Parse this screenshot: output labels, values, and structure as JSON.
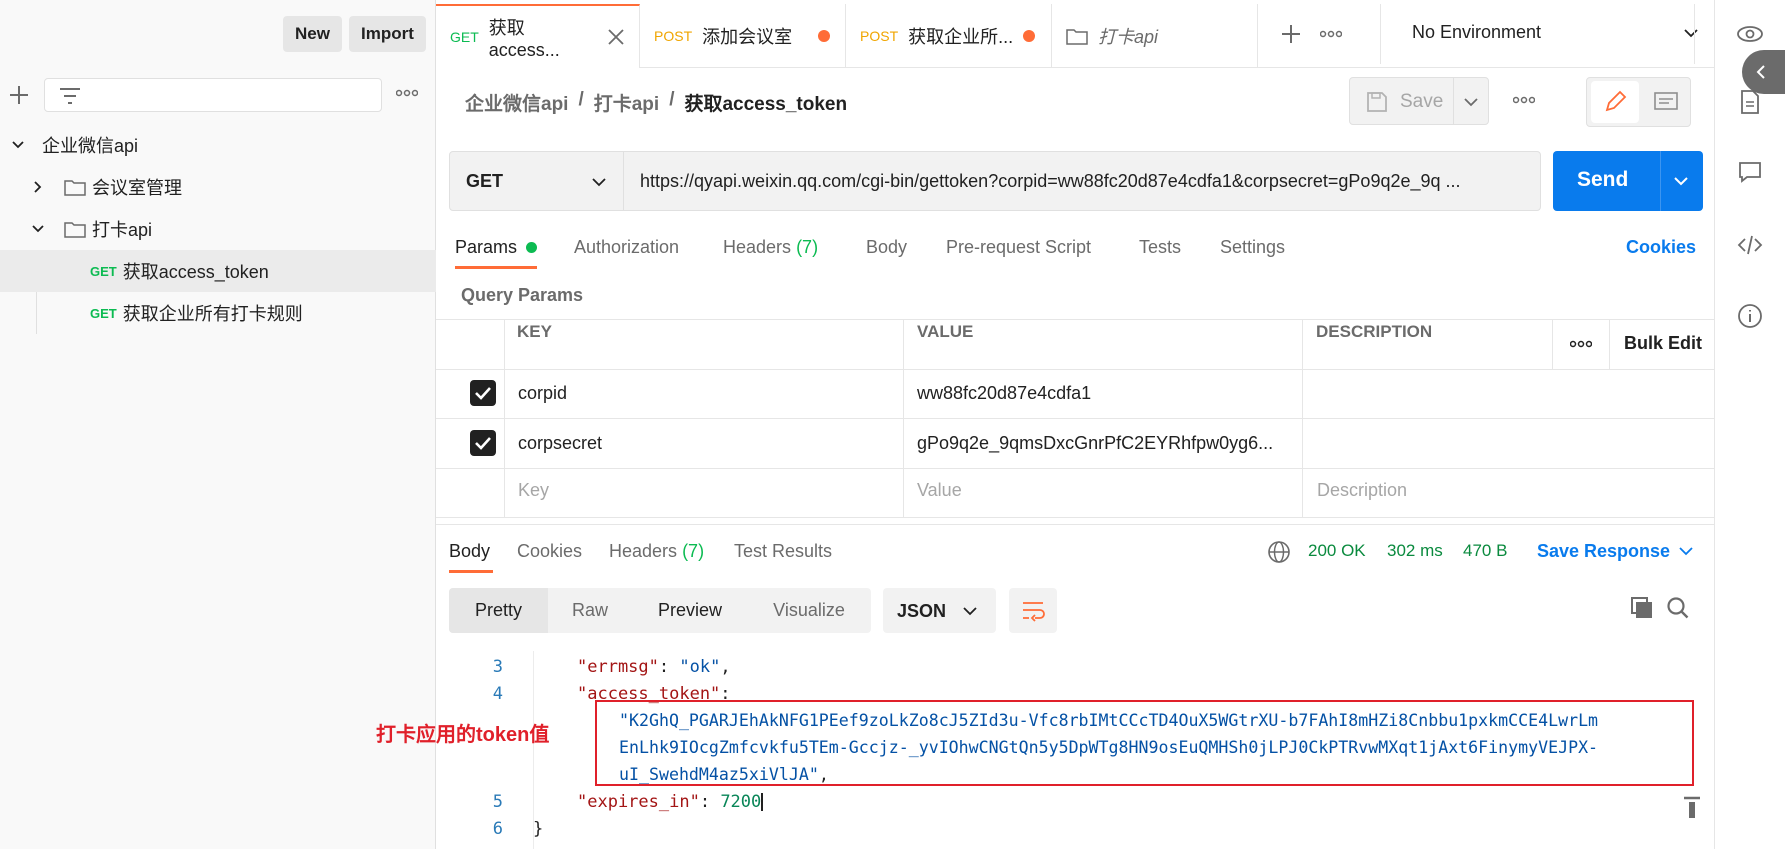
{
  "sidebar": {
    "new_label": "New",
    "import_label": "Import",
    "tree": [
      {
        "label": "企业微信api",
        "level": 0
      },
      {
        "label": "会议室管理",
        "level": 1
      },
      {
        "label": "打卡api",
        "level": 1
      },
      {
        "method": "GET",
        "label": "获取access_token",
        "level": 2
      },
      {
        "method": "GET",
        "label": "获取企业所有打卡规则",
        "level": 2
      }
    ]
  },
  "tabs": [
    {
      "method": "GET",
      "label": "获取access...",
      "method_color": "#0cbb52"
    },
    {
      "method": "POST",
      "label": "添加会议室",
      "method_color": "#f0a500"
    },
    {
      "method": "POST",
      "label": "获取企业所...",
      "method_color": "#f0a500"
    },
    {
      "label": "打卡api"
    }
  ],
  "environment": "No Environment",
  "breadcrumb": [
    "企业微信api",
    "/",
    "打卡api",
    "/",
    "获取access_token"
  ],
  "save_label": "Save",
  "request": {
    "method": "GET",
    "url": "https://qyapi.weixin.qq.com/cgi-bin/gettoken?corpid=ww88fc20d87e4cdfa1&corpsecret=gPo9q2e_9q ...",
    "send_label": "Send"
  },
  "req_tabs": {
    "params": "Params",
    "authorization": "Authorization",
    "headers": "Headers",
    "headers_count": "(7)",
    "body": "Body",
    "prerequest": "Pre-request Script",
    "tests": "Tests",
    "settings": "Settings",
    "cookies": "Cookies"
  },
  "query_params": {
    "title": "Query Params",
    "columns": [
      "KEY",
      "VALUE",
      "DESCRIPTION"
    ],
    "bulk_edit": "Bulk Edit",
    "rows": [
      {
        "key": "corpid",
        "value": "ww88fc20d87e4cdfa1"
      },
      {
        "key": "corpsecret",
        "value": "gPo9q2e_9qmsDxcGnrPfC2EYRhfpw0yg6..."
      }
    ],
    "placeholder": {
      "key": "Key",
      "value": "Value",
      "description": "Description"
    }
  },
  "response": {
    "tabs": {
      "body": "Body",
      "cookies": "Cookies",
      "headers": "Headers",
      "headers_count": "(7)",
      "test_results": "Test Results"
    },
    "status": "200 OK",
    "time": "302 ms",
    "size": "470 B",
    "save_response": "Save Response",
    "views": [
      "Pretty",
      "Raw",
      "Preview",
      "Visualize"
    ],
    "format": "JSON",
    "lines": {
      "l3": "3",
      "l4": "4",
      "l5": "5",
      "l6": "6",
      "errmsg_key": "\"errmsg\"",
      "errmsg_val": "\"ok\"",
      "token_key": "\"access_token\"",
      "token_1": "\"K2GhQ_PGARJEhAkNFG1PEef9zoLkZo8cJ5ZId3u-Vfc8rbIMtCCcTD4OuX5WGtrXU-b7FAhI8mHZi8Cnbbu1pxkmCCE4LwrLm",
      "token_2": "EnLhk9IOcgZmfcvkfu5TEm-Gccjz-_yvIOhwCNGtQn5y5DpWTg8HN9osEuQMHSh0jLPJ0CkPTRvwMXqt1jAxt6FinymyVEJPX-",
      "token_3": "uI_SwehdM4az5xiVlJA\"",
      "expires_key": "\"expires_in\"",
      "expires_val": "7200",
      "close_brace": "}"
    }
  },
  "annotation": {
    "label": "打卡应用的token值",
    "color": "#e0202a"
  },
  "colors": {
    "accent": "#ff6c37",
    "send": "#097bed",
    "status_green": "#0cbb52"
  }
}
